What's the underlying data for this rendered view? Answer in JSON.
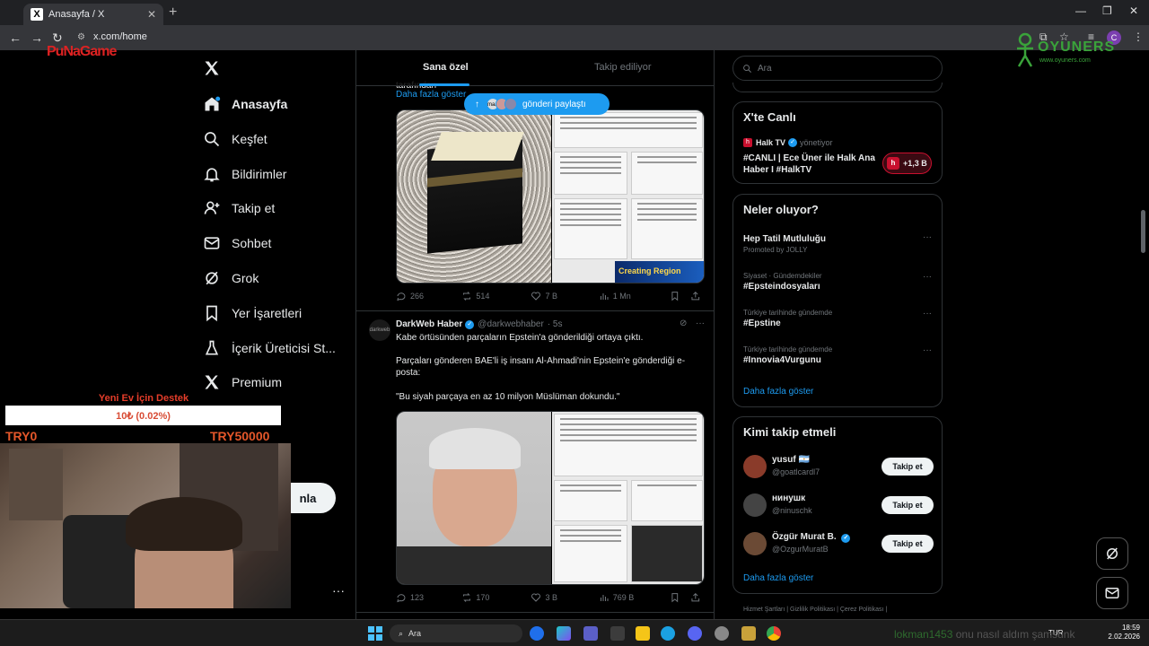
{
  "browser": {
    "tab_title": "Anasayfa / X",
    "url": "x.com/home",
    "profile_initial": "C"
  },
  "overlay": {
    "left_logo": "PuNaGame",
    "right_logo": "OYUNERS",
    "right_logo_sub": "www.oyuners.com",
    "donate_title": "Yeni Ev İçin Destek",
    "donate_value": "10₺ (0.02%)",
    "donate_progress_percent": 0.02,
    "donate_min": "TRY0",
    "donate_max": "TRY50000",
    "chat_user": "lokman1453",
    "chat_text": "onu nasıl aldım şamsunk"
  },
  "nav": {
    "items": [
      {
        "label": "Anasayfa",
        "icon": "home-icon"
      },
      {
        "label": "Keşfet",
        "icon": "search-icon"
      },
      {
        "label": "Bildirimler",
        "icon": "bell-icon"
      },
      {
        "label": "Takip et",
        "icon": "follow-icon"
      },
      {
        "label": "Sohbet",
        "icon": "mail-icon"
      },
      {
        "label": "Grok",
        "icon": "grok-icon"
      },
      {
        "label": "Yer İşaretleri",
        "icon": "bookmark-icon"
      },
      {
        "label": "İçerik Üreticisi St...",
        "icon": "creator-icon"
      },
      {
        "label": "Premium",
        "icon": "x-icon"
      }
    ],
    "post_button_partial": "nla"
  },
  "timeline": {
    "tab_for_you": "Sana özel",
    "tab_following": "Takip ediliyor",
    "truncated_text": "tarafından",
    "show_more": "Daha fazla göster",
    "share_pill": "gönderi paylaştı",
    "share_avatar_label": "maas",
    "tweet1": {
      "banner": "Creating  Region",
      "replies": "266",
      "retweets": "514",
      "likes": "7 B",
      "views": "1 Mn"
    },
    "tweet2": {
      "avatar_label": "darkweb",
      "name": "DarkWeb Haber",
      "handle": "@darkwebhaber",
      "time": "· 5s",
      "text1": "Kabe örtüsünden parçaların Epstein'a gönderildiği ortaya çıktı.",
      "text2": "Parçaları gönderen BAE'li iş insanı Al-Ahmadi'nin Epstein'e gönderdiği e-posta:",
      "text3": "\"Bu siyah parçaya en az 10 milyon Müslüman dokundu.\"",
      "replies": "123",
      "retweets": "170",
      "likes": "3 B",
      "views": "769 B"
    }
  },
  "sidebar": {
    "search_placeholder": "Ara",
    "live": {
      "title": "X'te Canlı",
      "host": "Halk TV",
      "host_suffix": "yönetiyor",
      "text": "#CANLI | Ece Üner ile Halk Ana Haber I #HalkTV",
      "count": "+1,3 B"
    },
    "trends": {
      "title": "Neler oluyor?",
      "items": [
        {
          "context": "",
          "topic": "Hep Tatil Mutluluğu",
          "promo": "Promoted by JOLLY"
        },
        {
          "context": "Siyaset · Gündemdekiler",
          "topic": "#Epsteindosyaları",
          "promo": ""
        },
        {
          "context": "Türkiye tarihinde gündemde",
          "topic": "#Epstine",
          "promo": ""
        },
        {
          "context": "Türkiye tarihinde gündemde",
          "topic": "#Innovia4Vurgunu",
          "promo": ""
        }
      ],
      "show_more": "Daha fazla göster"
    },
    "who_to_follow": {
      "title": "Kimi takip etmeli",
      "users": [
        {
          "name": "yusuf 🇦🇷",
          "handle": "@goatlcardl7",
          "button": "Takip et",
          "color": "#8a3b2a"
        },
        {
          "name": "нинушк",
          "handle": "@ninuschk",
          "button": "Takip et",
          "color": "#444"
        },
        {
          "name": "Özgür Murat B.",
          "handle": "@OzgurMuratB",
          "button": "Takip et",
          "color": "#6b4a35"
        }
      ],
      "show_more": "Daha fazla göster"
    },
    "footer": "Hizmet Şartları  |  Gizlilik Politikası  |  Çerez Politikası  |"
  },
  "taskbar": {
    "search": "Ara",
    "lang": "TUR",
    "time": "18:59",
    "date": "2.02.2026"
  }
}
